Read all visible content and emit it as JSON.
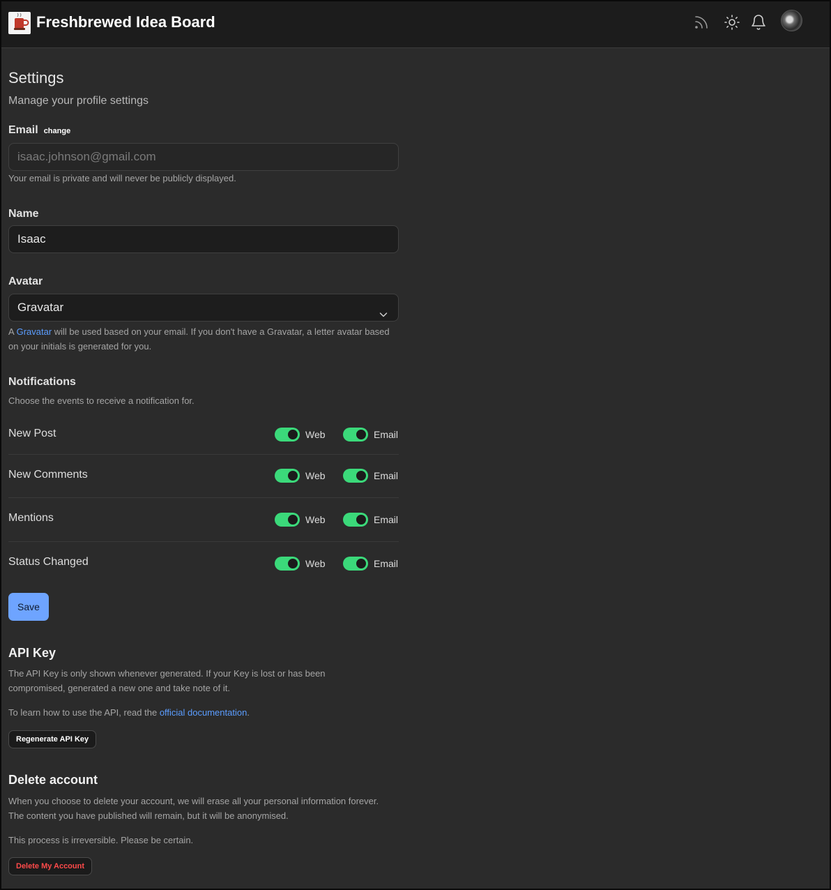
{
  "header": {
    "brand": "Freshbrewed Idea Board",
    "icons": [
      "rss-icon",
      "sun-icon",
      "bell-icon"
    ]
  },
  "settings": {
    "title": "Settings",
    "subtitle": "Manage your profile settings"
  },
  "email": {
    "label": "Email",
    "change_label": "change",
    "value": "isaac.johnson@gmail.com",
    "help": "Your email is private and will never be publicly displayed."
  },
  "name": {
    "label": "Name",
    "value": "Isaac"
  },
  "avatar": {
    "label": "Avatar",
    "selected": "Gravatar",
    "help_prefix": "A ",
    "help_link": "Gravatar",
    "help_suffix": " will be used based on your email. If you don't have a Gravatar, a letter avatar based on your initials is generated for you."
  },
  "notifications": {
    "title": "Notifications",
    "description": "Choose the events to receive a notification for.",
    "web_label": "Web",
    "email_label": "Email",
    "rows": [
      {
        "name": "New Post",
        "web": true,
        "email": true
      },
      {
        "name": "New Comments",
        "web": true,
        "email": true
      },
      {
        "name": "Mentions",
        "web": true,
        "email": true
      },
      {
        "name": "Status Changed",
        "web": true,
        "email": true
      }
    ]
  },
  "save_label": "Save",
  "api_key": {
    "title": "API Key",
    "description": "The API Key is only shown whenever generated. If your Key is lost or has been compromised, generated a new one and take note of it.",
    "learn_prefix": "To learn how to use the API, read the ",
    "learn_link": "official documentation",
    "learn_suffix": ".",
    "button_label": "Regenerate API Key"
  },
  "delete_account": {
    "title": "Delete account",
    "description": "When you choose to delete your account, we will erase all your personal information forever. The content you have published will remain, but it will be anonymised.",
    "warning": "This process is irreversible. Please be certain.",
    "button_label": "Delete My Account"
  },
  "colors": {
    "background": "#2b2b2b",
    "header": "#1c1c1c",
    "toggle_on": "#3bd97a",
    "save_button": "#6ea4ff",
    "link": "#5b9dff",
    "danger": "#ff4a4a"
  }
}
